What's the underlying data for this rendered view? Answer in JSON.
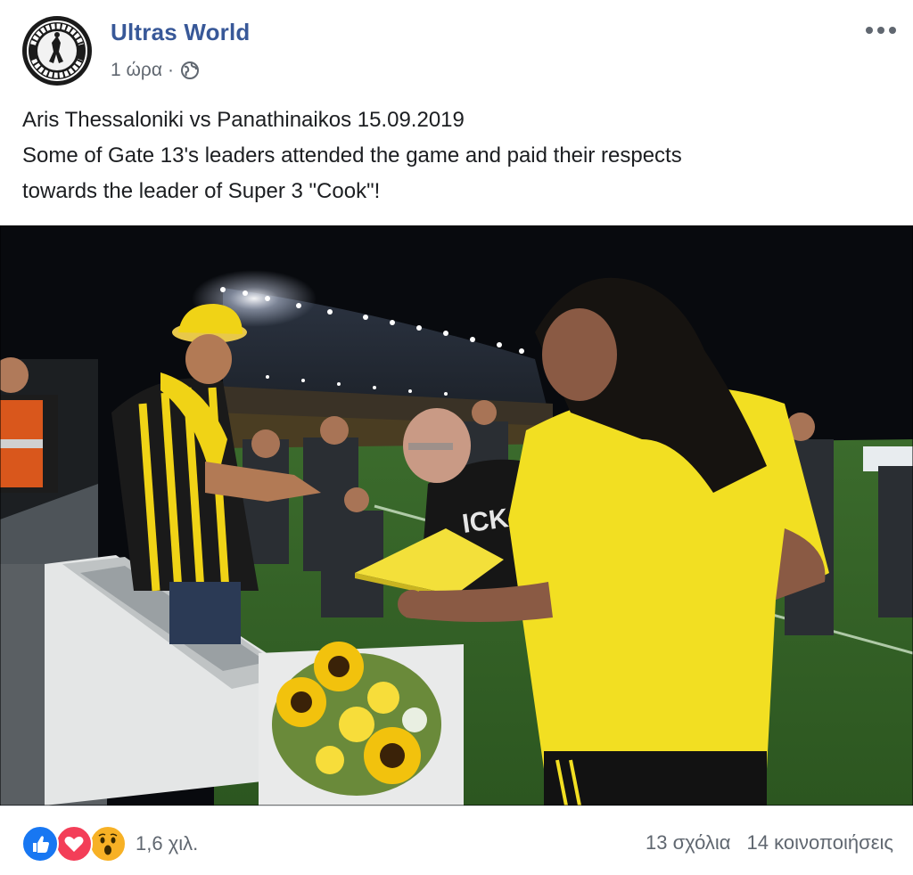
{
  "post": {
    "author": "Ultras World",
    "avatar_text_top": "ULTRAS",
    "avatar_text_bottom": "WORLD",
    "time": "1 ώρα",
    "separator": "·",
    "privacy_icon": "globe-icon",
    "more_icon": "more-options-icon",
    "text_lines": [
      "Aris Thessaloniki vs Panathinaikos 15.09.2019",
      "Some of Gate 13's leaders attended the game and paid their respects",
      "towards the leader of Super 3 \"Cook\"!"
    ],
    "photo_icon": "stadium-photo"
  },
  "footer": {
    "reaction_icons": [
      "like-icon",
      "love-icon",
      "wow-icon"
    ],
    "reaction_count": "1,6 χιλ.",
    "comments": "13 σχόλια",
    "shares": "14 κοινοποιήσεις"
  },
  "colors": {
    "author": "#385898",
    "muted": "#606770",
    "like": "#1877f2",
    "love": "#f33e58",
    "wow": "#f7b125"
  }
}
